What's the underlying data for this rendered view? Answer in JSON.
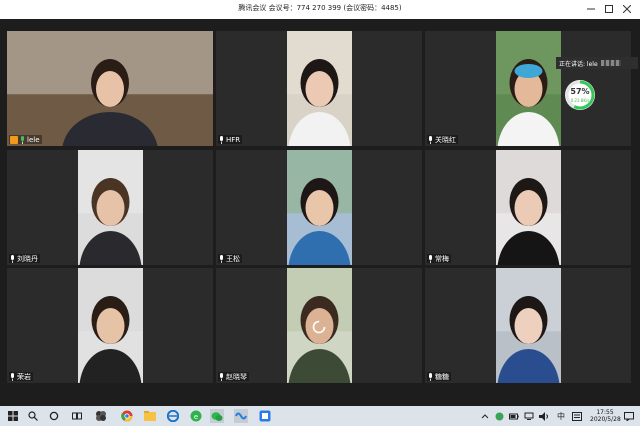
{
  "window": {
    "title": "腾讯会议 会议号：774 270 399  (会议密码：4485)"
  },
  "speaking": {
    "label": "正在讲话: lele"
  },
  "network": {
    "percent": "57%",
    "rate": "0.23.8K/s"
  },
  "participants": [
    {
      "name": "lele",
      "host": true,
      "bg": "#6e5a45",
      "skin": "#e7c2a6",
      "hair": "#2a1d16",
      "shirt": "#2a2a33",
      "wall": "#cfc8bd"
    },
    {
      "name": "HFR",
      "host": false,
      "bg": "#d9d2c6",
      "skin": "#ecc9b2",
      "hair": "#1d1715",
      "shirt": "#f2f2f2",
      "wall": "#e9e3d8"
    },
    {
      "name": "关晓红",
      "host": false,
      "bg": "#5f8a52",
      "skin": "#e3b99a",
      "hair": "#2a1d16",
      "shirt": "#f4f4f4",
      "wall": "#7aa36b",
      "cap": "#3fa7d6"
    },
    {
      "name": "刘晓丹",
      "host": false,
      "bg": "#dcdcdc",
      "skin": "#e6c3a8",
      "hair": "#4a3424",
      "shirt": "#2a2a2e",
      "wall": "#ebebeb"
    },
    {
      "name": "王松",
      "host": false,
      "bg": "#a7bdd4",
      "skin": "#e9c5aa",
      "hair": "#1d1715",
      "shirt": "#2f6fb0",
      "wall": "#8bb07a"
    },
    {
      "name": "常梅",
      "host": false,
      "bg": "#e8e6e6",
      "skin": "#eccbb6",
      "hair": "#1d1715",
      "shirt": "#151515",
      "wall": "#d5d0cf"
    },
    {
      "name": "荣岩",
      "host": false,
      "bg": "#e1e1e1",
      "skin": "#e6c2a6",
      "hair": "#2a1d16",
      "shirt": "#222222",
      "wall": "#d8d8d8"
    },
    {
      "name": "赵晓琴",
      "host": false,
      "bg": "#cfd6c3",
      "skin": "#dcb294",
      "hair": "#3a2a20",
      "shirt": "#3d4a35",
      "wall": "#b8c6a8"
    },
    {
      "name": "糖糖",
      "host": false,
      "bg": "#b9c0c7",
      "skin": "#edd0be",
      "hair": "#1d1715",
      "shirt": "#2a4d8f",
      "wall": "#d9dde1"
    }
  ],
  "taskbar": {
    "time": "17:55",
    "date": "2020/5/28",
    "ime": "中"
  }
}
